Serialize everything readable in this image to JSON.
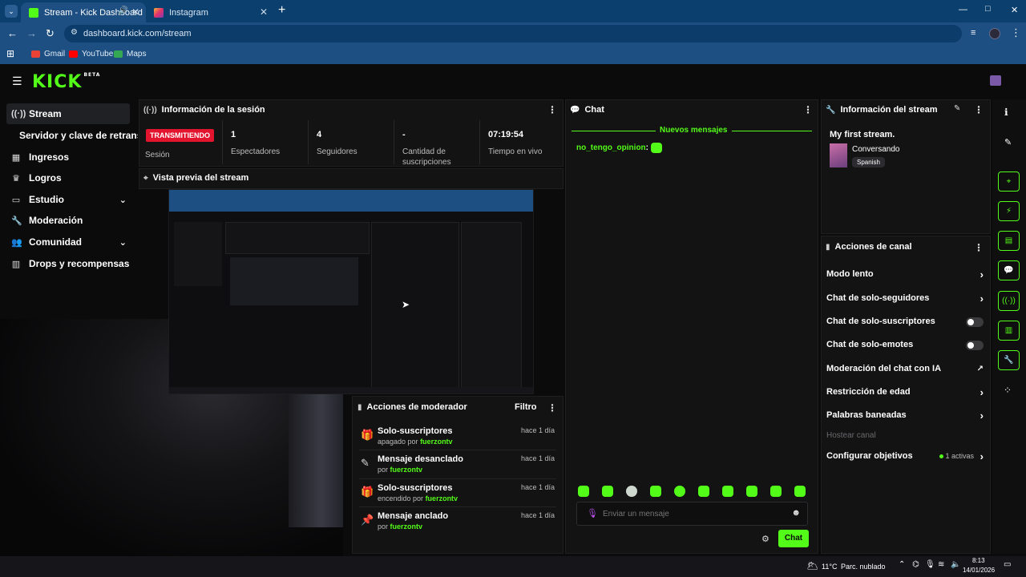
{
  "browser": {
    "tabs": [
      {
        "title": "Stream - Kick Dashboard",
        "active": true
      },
      {
        "title": "Instagram",
        "active": false
      }
    ],
    "new_tab": "+",
    "url": "dashboard.kick.com/stream",
    "bookmarks": [
      "Gmail",
      "YouTube",
      "Maps"
    ],
    "window_controls": [
      "—",
      "□",
      "✕"
    ]
  },
  "header": {
    "logo": "KICK",
    "logo_badge": "BETA"
  },
  "sidebar": {
    "items": [
      {
        "label": "Stream",
        "icon": "broadcast-icon",
        "active": true
      },
      {
        "label": "Servidor y clave de retransm",
        "icon": ""
      },
      {
        "label": "Ingresos",
        "icon": "chart-icon"
      },
      {
        "label": "Logros",
        "icon": "trophy-icon"
      },
      {
        "label": "Estudio",
        "icon": "studio-icon",
        "expand": true
      },
      {
        "label": "Moderación",
        "icon": "wrench-icon"
      },
      {
        "label": "Comunidad",
        "icon": "users-icon",
        "expand": true
      },
      {
        "label": "Drops y recompensas",
        "icon": "drops-icon"
      }
    ]
  },
  "session": {
    "title": "Información de la sesión",
    "status_badge": "TRANSMITIENDO",
    "status_label": "Sesión",
    "viewers_value": "1",
    "viewers_label": "Espectadores",
    "followers_value": "4",
    "followers_label": "Seguidores",
    "subs_value": "-",
    "subs_label": "Cantidad de suscripciones",
    "uptime_value": "07:19:54",
    "uptime_label": "Tiempo en vivo"
  },
  "preview": {
    "title": "Vista previa del stream"
  },
  "mod_actions": {
    "title": "Acciones de moderador",
    "filter": "Filtro",
    "rows": [
      {
        "title": "Solo-suscriptores",
        "prefix": "apagado por",
        "user": "fuerzontv",
        "time": "hace 1 día",
        "icon": "gift-icon"
      },
      {
        "title": "Mensaje desanclado",
        "prefix": "por",
        "user": "fuerzontv",
        "time": "hace 1 día",
        "icon": "unpin-icon"
      },
      {
        "title": "Solo-suscriptores",
        "prefix": "encendido por",
        "user": "fuerzontv",
        "time": "hace 1 día",
        "icon": "gift-icon"
      },
      {
        "title": "Mensaje anclado",
        "prefix": "por",
        "user": "fuerzontv",
        "time": "hace 1 día",
        "icon": "pin-icon"
      }
    ]
  },
  "chat": {
    "title": "Chat",
    "new_messages": "Nuevos mensajes",
    "message_user": "no_tengo_opinion",
    "input_placeholder": "Enviar un mensaje",
    "send_button": "Chat"
  },
  "stream_info": {
    "title": "Información del stream",
    "stream_title": "My first stream.",
    "category": "Conversando",
    "language": "Spanish"
  },
  "channel_actions": {
    "title": "Acciones de canal",
    "items": [
      {
        "label": "Modo lento",
        "control": "chevron"
      },
      {
        "label": "Chat de solo-seguidores",
        "control": "chevron"
      },
      {
        "label": "Chat de solo-suscriptores",
        "control": "toggle"
      },
      {
        "label": "Chat de solo-emotes",
        "control": "toggle"
      },
      {
        "label": "Moderación del chat con IA",
        "control": "external"
      },
      {
        "label": "Restricción de edad",
        "control": "chevron"
      },
      {
        "label": "Palabras baneadas",
        "control": "chevron"
      },
      {
        "label": "Hostear canal",
        "control": "disabled"
      },
      {
        "label": "Configurar objetivos",
        "control": "chevron",
        "extra": "1 activas"
      }
    ]
  },
  "taskbar": {
    "weather": "11°C",
    "weather_desc": "Parc. nublado",
    "time": "8:13",
    "date": "14/01/2026"
  },
  "colors": {
    "accent": "#53fc18",
    "live": "#e3142d",
    "bg": "#0b0b0c",
    "panel": "#131314",
    "chrome": "#1d4f82"
  }
}
